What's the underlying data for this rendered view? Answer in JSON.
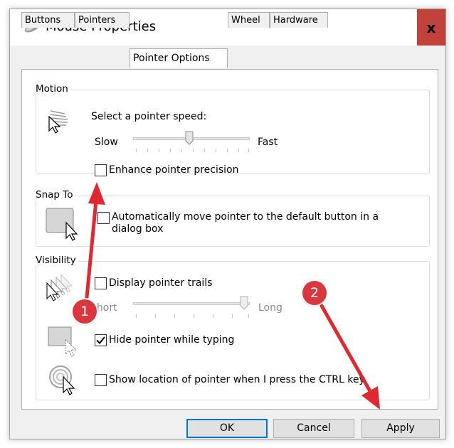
{
  "window": {
    "title": "Mouse Properties",
    "close_label": "x"
  },
  "tabs": [
    {
      "label": "Buttons",
      "active": false
    },
    {
      "label": "Pointers",
      "active": false
    },
    {
      "label": "Pointer Options",
      "active": true
    },
    {
      "label": "Wheel",
      "active": false
    },
    {
      "label": "Hardware",
      "active": false
    }
  ],
  "motion": {
    "group_label": "Motion",
    "speed_label": "Select a pointer speed:",
    "slow_label": "Slow",
    "fast_label": "Fast",
    "speed_level": 0.5,
    "enhance_precision": {
      "label": "Enhance pointer precision",
      "checked": false
    }
  },
  "snap_to": {
    "group_label": "Snap To",
    "auto_move": {
      "label_line1": "Automatically move pointer to the default button in a",
      "label_line2": "dialog box",
      "checked": false
    }
  },
  "visibility": {
    "group_label": "Visibility",
    "trails": {
      "label": "Display pointer trails",
      "checked": false
    },
    "short_label": "Short",
    "long_label": "Long",
    "trail_level": 1.0,
    "hide_typing": {
      "label": "Hide pointer while typing",
      "checked": true
    },
    "show_location": {
      "label": "Show location of pointer when I press the CTRL key",
      "checked": false
    }
  },
  "footer": {
    "ok_label": "OK",
    "cancel_label": "Cancel",
    "apply_label": "Apply"
  },
  "annotations": {
    "badge_1": "1",
    "badge_2": "2",
    "arrow_color": "#e0292f"
  },
  "icons": [
    "mouse-icon",
    "close-icon",
    "pointer-speed-icon",
    "snap-to-icon",
    "pointer-trails-icon",
    "hide-pointer-icon",
    "show-location-icon"
  ]
}
